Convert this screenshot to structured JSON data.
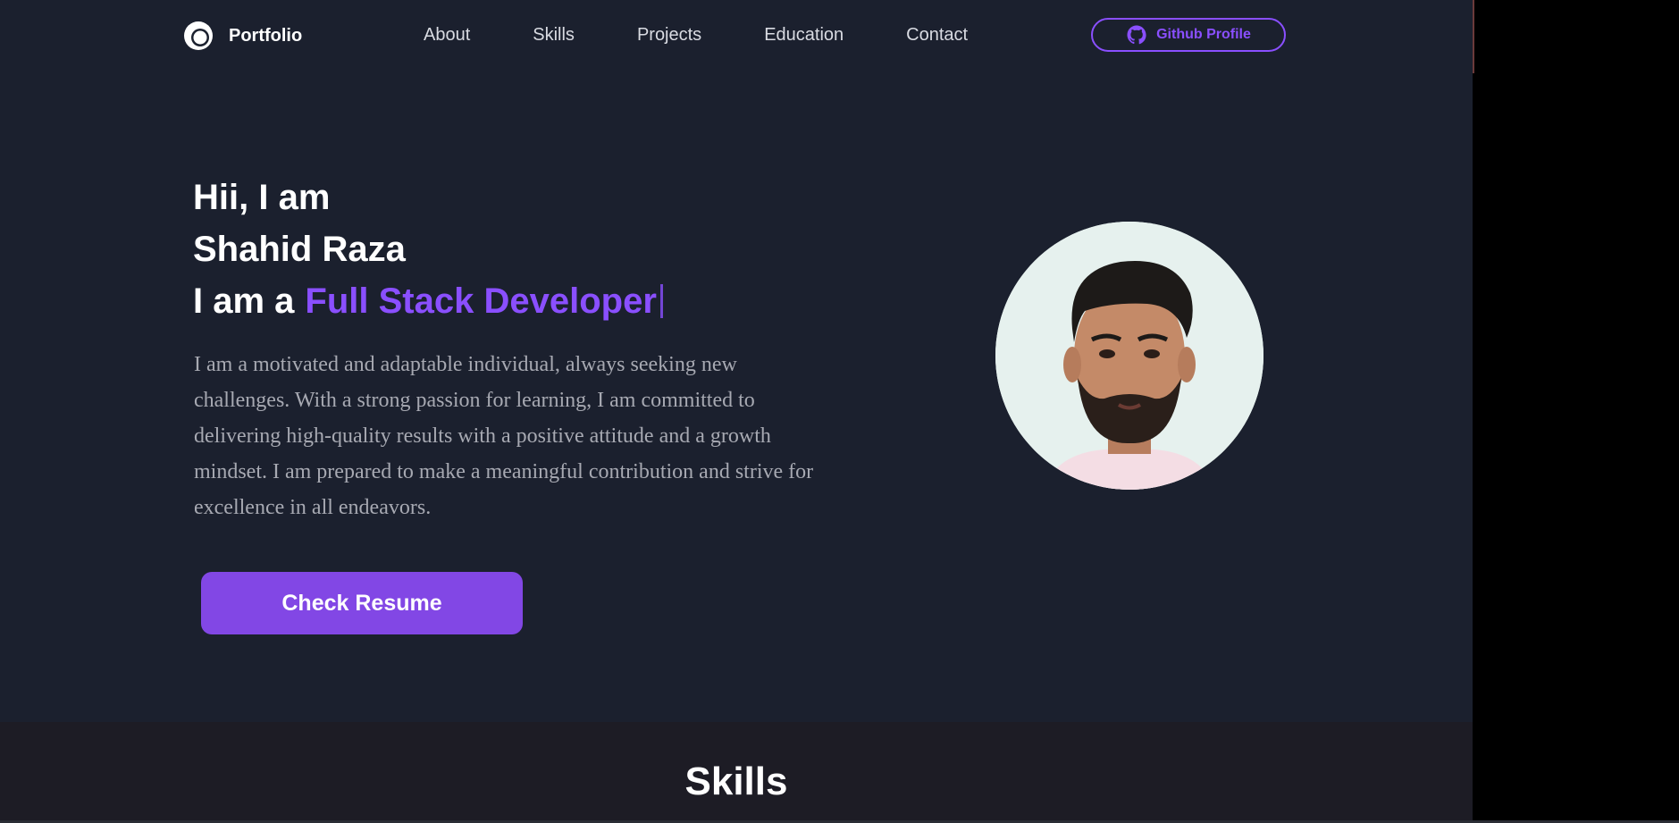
{
  "nav": {
    "brand": "Portfolio",
    "links": [
      "About",
      "Skills",
      "Projects",
      "Education",
      "Contact"
    ],
    "github_label": "Github Profile",
    "icons": {
      "logo": "logo-ring-icon",
      "github": "github-icon"
    }
  },
  "hero": {
    "line1": "Hii, I am",
    "line2": "Shahid Raza",
    "line3_prefix": "I am a",
    "role": "Full Stack Developer",
    "description": "I am a motivated and adaptable individual, always seeking new challenges. With a strong passion for learning, I am committed to delivering high-quality results with a positive attitude and a growth mindset. I am prepared to make a meaningful contribution and strive for excellence in all endeavors.",
    "resume_label": "Check Resume"
  },
  "skills": {
    "title": "Skills"
  },
  "colors": {
    "background": "#1b202e",
    "accent": "#8a4fff",
    "button": "#8247e5",
    "text": "#ffffff",
    "muted": "#a7a9b2"
  }
}
